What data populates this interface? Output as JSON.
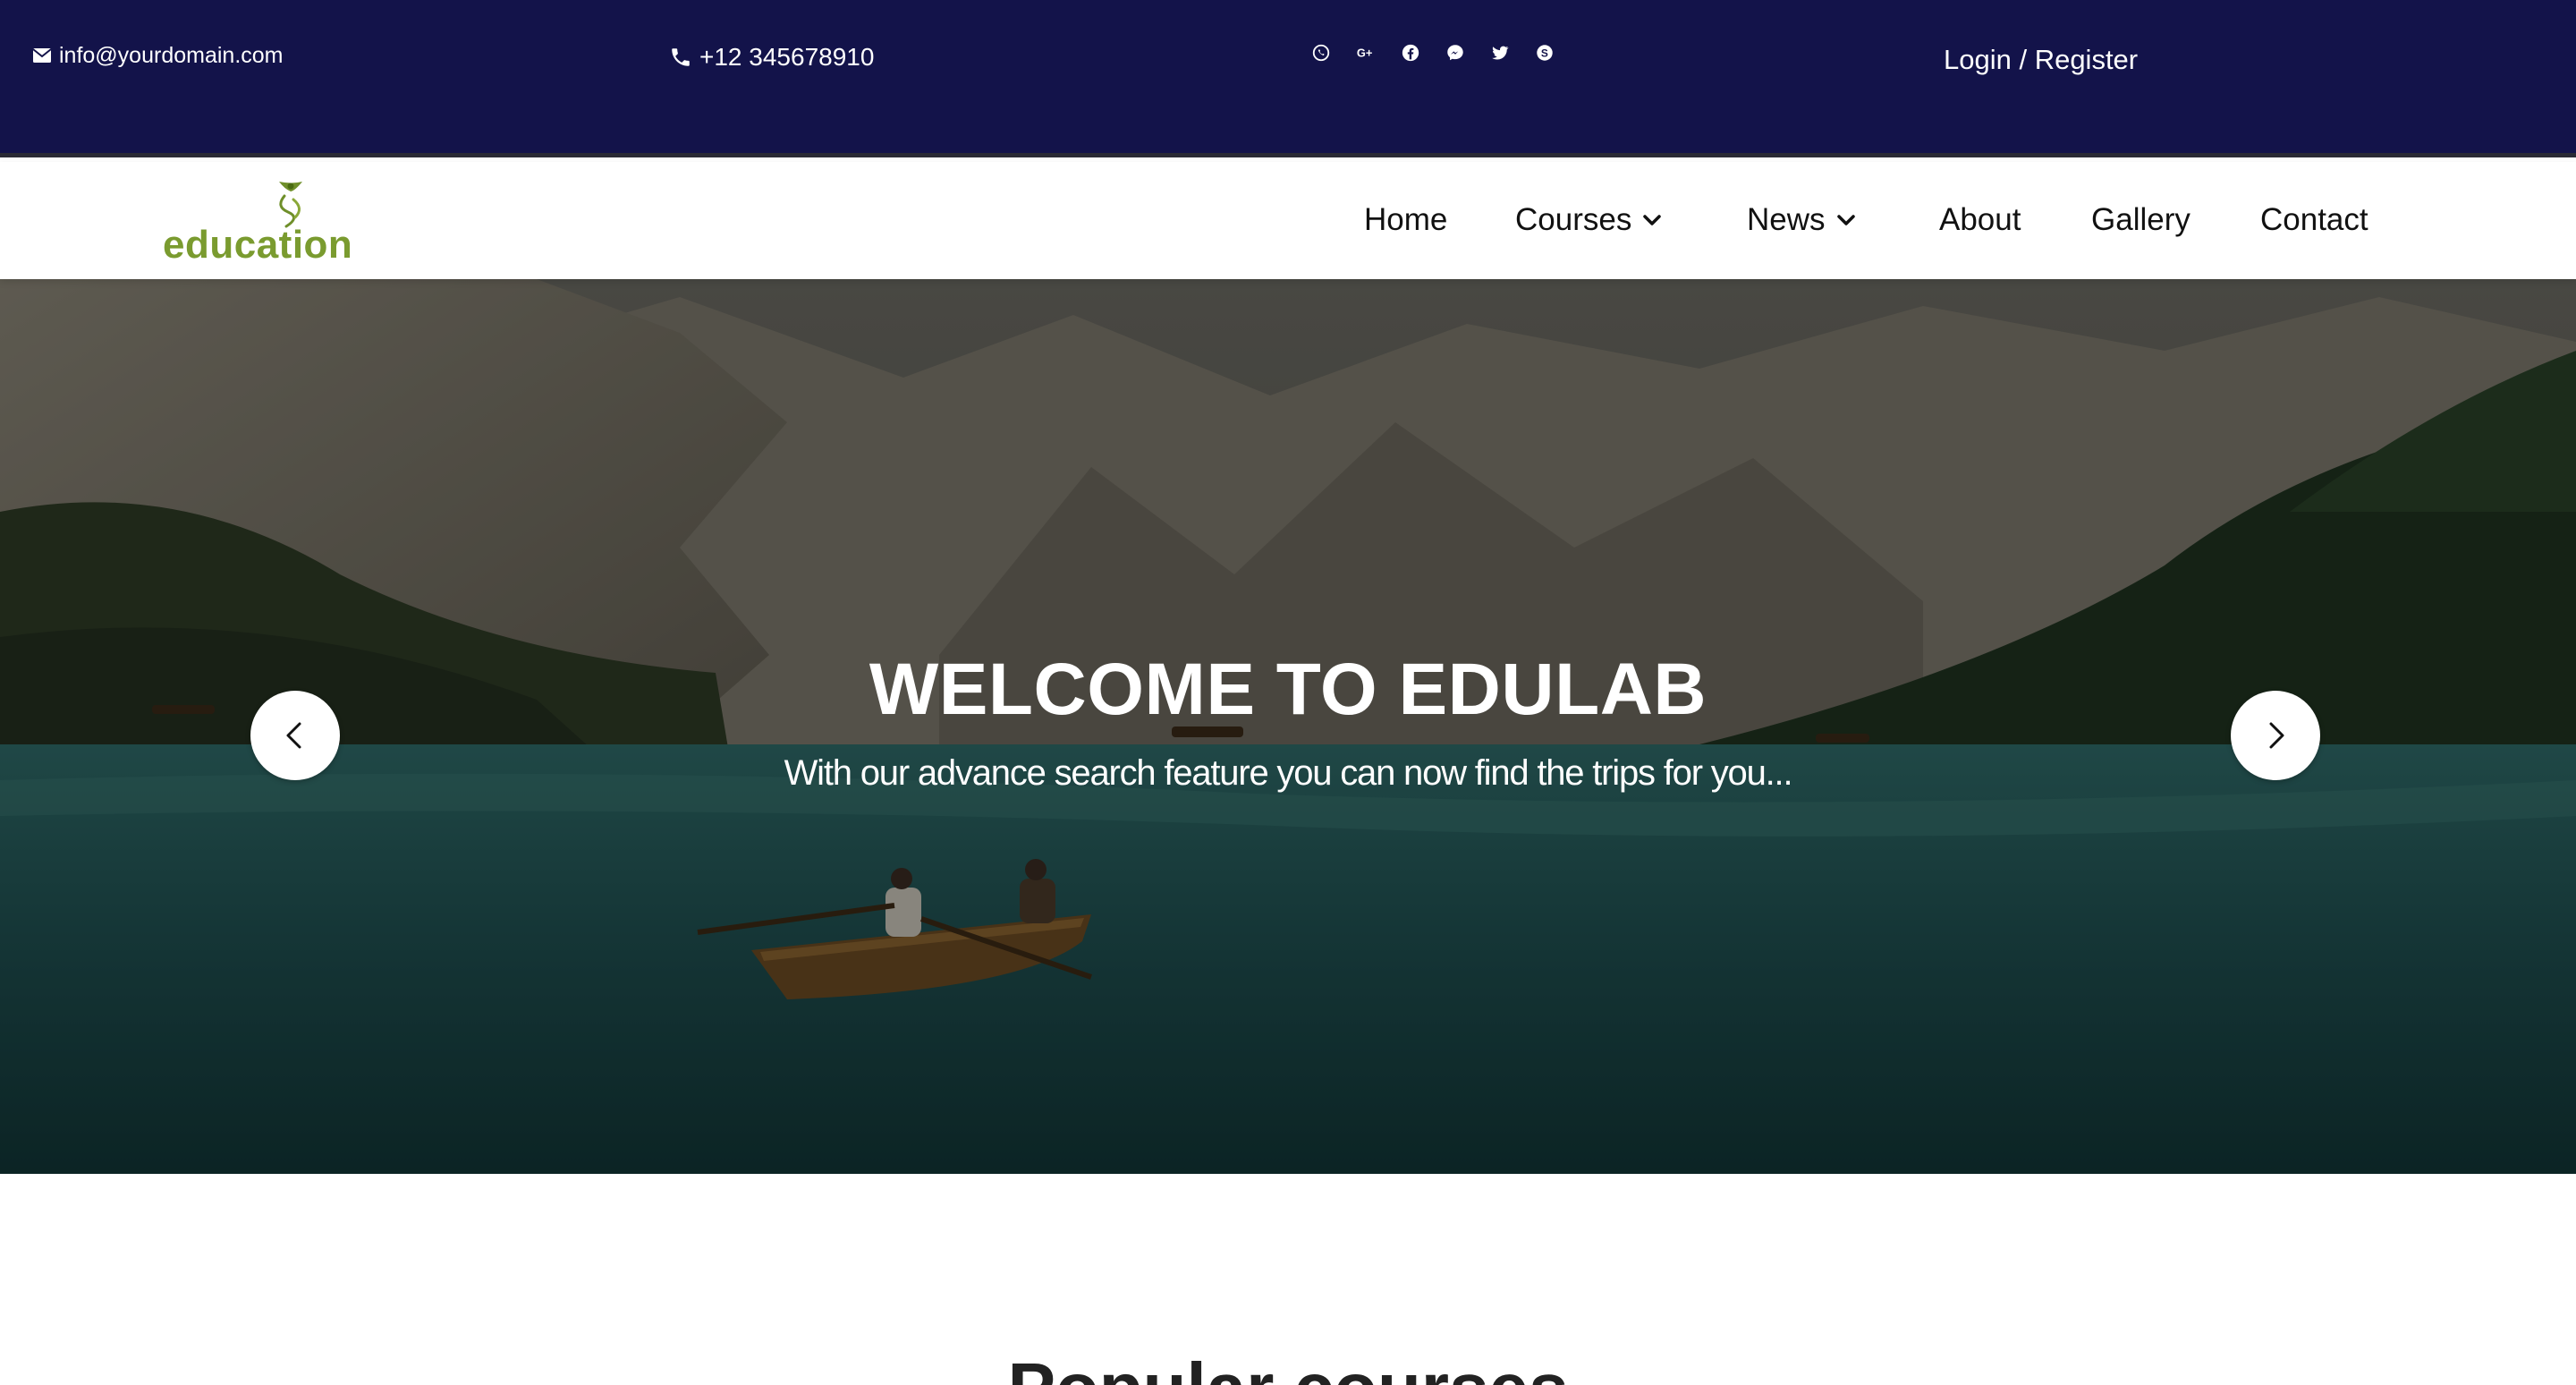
{
  "topbar": {
    "email": "info@yourdomain.com",
    "phone": "+12 345678910",
    "social_icons": [
      "whatsapp-icon",
      "google-plus-icon",
      "facebook-icon",
      "messenger-icon",
      "twitter-icon",
      "skype-icon"
    ],
    "login_label": "Login / Register",
    "background_color": "#13134a"
  },
  "navbar": {
    "logo_text": "education",
    "logo_color": "#7a9b2f",
    "items": [
      {
        "label": "Home"
      },
      {
        "label": "Courses",
        "has_dropdown": true
      },
      {
        "label": "News",
        "has_dropdown": true
      },
      {
        "label": "About"
      },
      {
        "label": "Gallery"
      },
      {
        "label": "Contact"
      }
    ]
  },
  "hero": {
    "title": "WELCOME TO EDULAB",
    "subtitle": "With our advance search feature you can now find the trips for you..."
  },
  "popular": {
    "heading": "Popular courses"
  }
}
